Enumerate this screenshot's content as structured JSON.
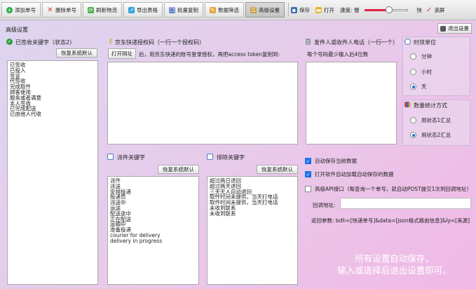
{
  "toolbar": {
    "add": "添加单号",
    "delete": "删除单号",
    "refresh": "刷新物流",
    "export": "导出表格",
    "batch_copy": "批量复制",
    "filter": "数据筛选",
    "settings": "高级设置",
    "save": "保存",
    "open": "打开",
    "speed_label": "速度: 慢",
    "speed_fast": "快",
    "scroll": "滚屏",
    "speed_value": 0.55
  },
  "page_title": "高级设置",
  "exit_settings": "退出设置",
  "signed": {
    "title": "已签收关键字（状态2）",
    "reset": "恢复系统默认",
    "items": "已签收\n已投入\n签妥\n代签收\n完成取件\n顾客使用\n服务或者满意\n本人签收\n已完成配送\n已由他人代收"
  },
  "jd": {
    "title": "京东快递授权码（一行一个授权码）",
    "open_url": "打开网址",
    "hint": "后，用京东快递的账号登录授权，再把access token复制到:",
    "items": ""
  },
  "phone": {
    "title": "发件人或收件人电话（一行一个）",
    "hint": "每个号码最少输入后4位数",
    "items": ""
  },
  "time_unit": {
    "title": "时效单位",
    "options": [
      "分钟",
      "小时",
      "天"
    ],
    "selected": 2
  },
  "stats": {
    "title": "数量统计方式",
    "options": [
      "用状态1汇总",
      "用状态2汇总"
    ],
    "selected": 1
  },
  "transit": {
    "title": "派件关键字",
    "reset": "恢复系统默认",
    "items": "派件\n派送\n安排投递\n投递员\n派送中\n运送\n配送途中\n正在配送\n运输中\n准备投递\ncourier for delivery\ndelivery in progress"
  },
  "exclude": {
    "title": "排除关键字",
    "reset": "恢复系统默认",
    "items": "超过两日退回\n超过两天退回\n三天无人自动退回\n取件时间未提供，当天打电话\n取件时间未提供，当天打电话\n未收到联系\n未收到联系"
  },
  "options": {
    "auto_save": "自动保存当前数据",
    "auto_save_on": true,
    "auto_load": "打开软件自动加载自动保存的数据",
    "auto_load_on": true,
    "api": "高级API接口（每查询一个单号，就自动POST提交1次到回调地址）",
    "api_on": false,
    "callback_label": "回调地址:",
    "return_params": "返回参数: bdh=[快递单号]&data=[json格式路由信息]&ly=[来源]"
  },
  "footer_line1": "所有设置自动保存，",
  "footer_line2": "输入或选择后退出设置即可。",
  "colors": {
    "accent": "#1a73e8",
    "add_icon": "#28a745",
    "delete_icon": "#e53935",
    "slider_fill": "#e22244"
  }
}
